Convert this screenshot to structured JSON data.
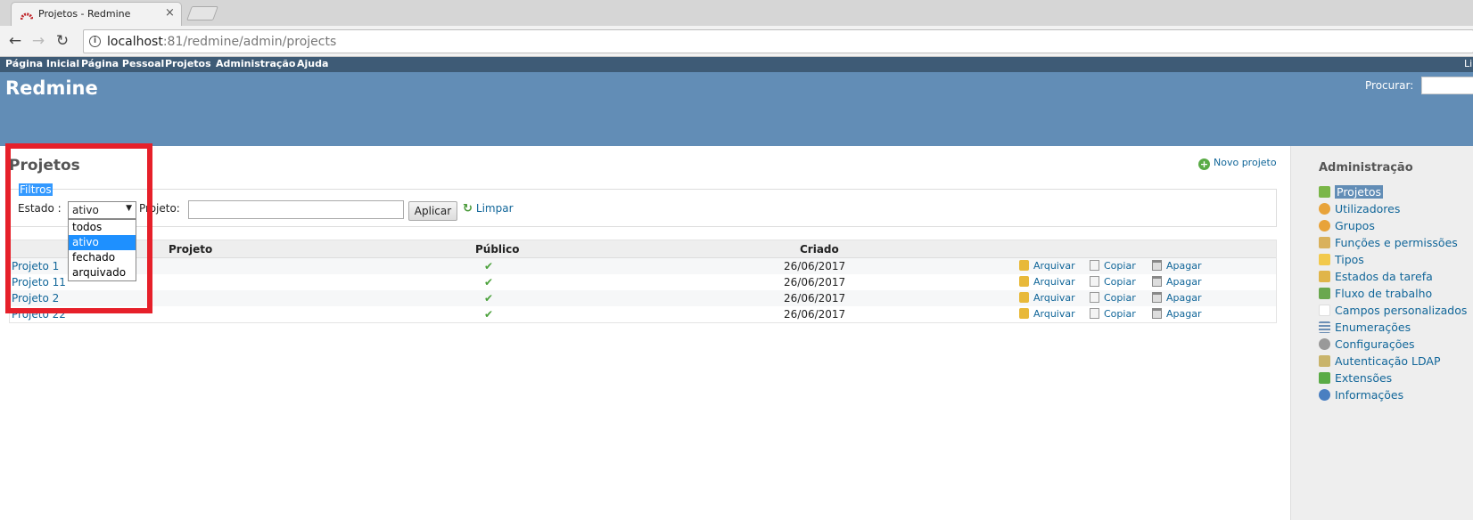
{
  "browser": {
    "tab_title": "Projetos - Redmine",
    "close_glyph": "×",
    "url_host": "localhost",
    "url_rest": ":81/redmine/admin/projects"
  },
  "top_menu": {
    "items": [
      "Página Inicial",
      "Página Pessoal",
      "Projetos",
      "Administração",
      "Ajuda"
    ],
    "right_text": "Li"
  },
  "header": {
    "title": "Redmine",
    "search_label": "Procurar:",
    "search_value": ""
  },
  "page": {
    "heading": "Projetos",
    "new_project_label": "Novo projeto"
  },
  "filters": {
    "legend": "Filtros",
    "status_label": "Estado :",
    "status_selected": "ativo",
    "status_options": [
      "todos",
      "ativo",
      "fechado",
      "arquivado"
    ],
    "project_label": "Projeto:",
    "project_value": "",
    "apply_label": "Aplicar",
    "clear_label": "Limpar"
  },
  "table": {
    "headers": [
      "Projeto",
      "Público",
      "Criado"
    ],
    "rows": [
      {
        "name": "Projeto 1",
        "created": "26/06/2017"
      },
      {
        "name": "Projeto 11",
        "created": "26/06/2017"
      },
      {
        "name": "Projeto 2",
        "created": "26/06/2017"
      },
      {
        "name": "Projeto 22",
        "created": "26/06/2017"
      }
    ],
    "public_check": "✔",
    "actions": {
      "archive": "Arquivar",
      "copy": "Copiar",
      "delete": "Apagar"
    }
  },
  "sidebar": {
    "title": "Administração",
    "items": [
      {
        "label": "Projetos",
        "icon": "projects-icon",
        "color": "#7ab648"
      },
      {
        "label": "Utilizadores",
        "icon": "user-icon",
        "color": "#e8a33a"
      },
      {
        "label": "Grupos",
        "icon": "group-icon",
        "color": "#e8a33a"
      },
      {
        "label": "Funções e permissões",
        "icon": "key-icon",
        "color": "#d9b15c"
      },
      {
        "label": "Tipos",
        "icon": "ticket-icon",
        "color": "#f2c94c"
      },
      {
        "label": "Estados da tarefa",
        "icon": "pencil-icon",
        "color": "#e0b54a"
      },
      {
        "label": "Fluxo de trabalho",
        "icon": "workflow-icon",
        "color": "#6aa84f"
      },
      {
        "label": "Campos personalizados",
        "icon": "fields-icon",
        "color": "#ffffff"
      },
      {
        "label": "Enumerações",
        "icon": "list-icon",
        "color": "#6d8fb5"
      },
      {
        "label": "Configurações",
        "icon": "gear-icon",
        "color": "#999999"
      },
      {
        "label": "Autenticação LDAP",
        "icon": "server-icon",
        "color": "#c9b46b"
      },
      {
        "label": "Extensões",
        "icon": "plugin-icon",
        "color": "#5aab46"
      },
      {
        "label": "Informações",
        "icon": "help-icon",
        "color": "#4a7fc1"
      }
    ]
  }
}
